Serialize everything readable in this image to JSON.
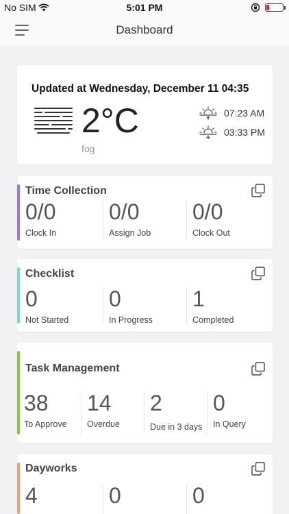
{
  "status_bar": {
    "carrier": "No SIM",
    "time": "5:01 PM"
  },
  "nav": {
    "title": "Dashboard"
  },
  "weather": {
    "updated": "Updated at Wednesday, December 11 04:35",
    "temperature": "2°C",
    "condition": "fog",
    "sunrise": "07:23 AM",
    "sunset": "03:33 PM"
  },
  "colors": {
    "time_collection": "#9a7bc9",
    "checklist": "#7fd6d2",
    "task_management": "#8cc63f",
    "dayworks": "#f0a07a",
    "battery_low": "#e02020"
  },
  "time_collection": {
    "title": "Time Collection",
    "stats": [
      {
        "value": "0/0",
        "label": "Clock In"
      },
      {
        "value": "0/0",
        "label": "Assign Job"
      },
      {
        "value": "0/0",
        "label": "Clock Out"
      }
    ]
  },
  "checklist": {
    "title": "Checklist",
    "stats": [
      {
        "value": "0",
        "label": "Not Started"
      },
      {
        "value": "0",
        "label": "In Progress"
      },
      {
        "value": "1",
        "label": "Completed"
      }
    ]
  },
  "task_management": {
    "title": "Task Management",
    "stats": [
      {
        "value": "38",
        "label": "To Approve"
      },
      {
        "value": "14",
        "label": "Overdue"
      },
      {
        "value": "2",
        "label": "Due in 3 days"
      },
      {
        "value": "0",
        "label": "In Query"
      }
    ]
  },
  "dayworks": {
    "title": "Dayworks",
    "stats": [
      {
        "value": "4"
      },
      {
        "value": "0"
      },
      {
        "value": "0"
      }
    ]
  },
  "icons": [
    "wifi-icon",
    "orientation-lock-icon",
    "battery-icon",
    "hamburger-menu-icon",
    "fog-icon",
    "sunrise-icon",
    "sunset-icon",
    "copy-icon"
  ]
}
